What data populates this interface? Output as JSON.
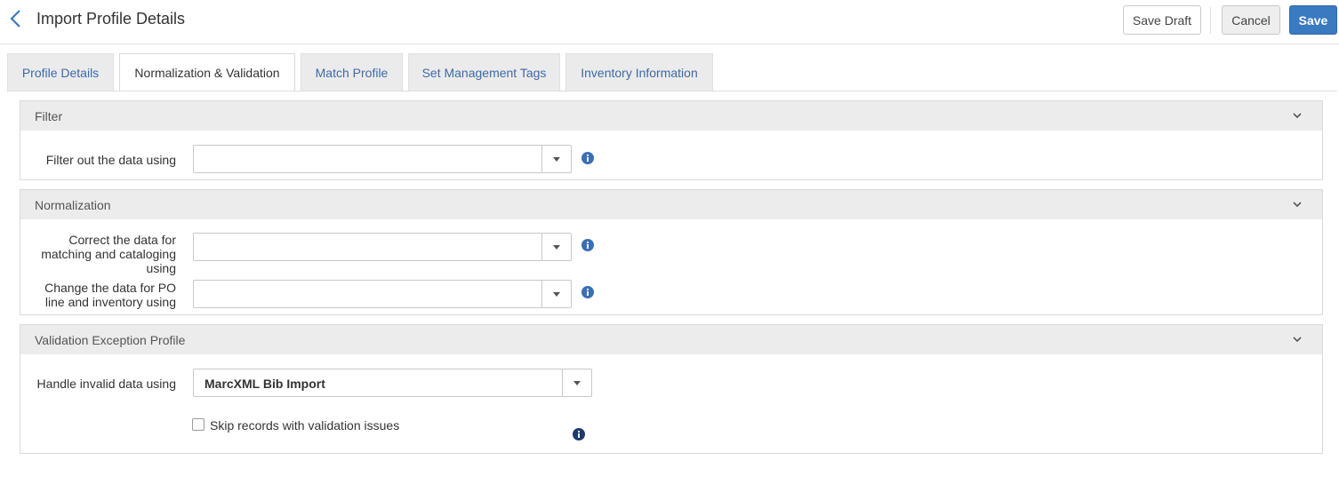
{
  "header": {
    "title": "Import Profile Details",
    "save_draft_label": "Save Draft",
    "cancel_label": "Cancel",
    "save_label": "Save"
  },
  "tabs": [
    {
      "label": "Profile Details",
      "active": false
    },
    {
      "label": "Normalization & Validation",
      "active": true
    },
    {
      "label": "Match Profile",
      "active": false
    },
    {
      "label": "Set Management Tags",
      "active": false
    },
    {
      "label": "Inventory Information",
      "active": false
    }
  ],
  "filter": {
    "title": "Filter",
    "filter_label": "Filter out the data using",
    "filter_value": ""
  },
  "normalization": {
    "title": "Normalization",
    "correct_label": "Correct the data for matching and cataloging using",
    "correct_value": "",
    "change_label": "Change the data for PO line and inventory using",
    "change_value": ""
  },
  "validation": {
    "title": "Validation Exception Profile",
    "handle_label": "Handle invalid data using",
    "handle_value": "MarcXML Bib Import",
    "skip_label": "Skip records with validation issues",
    "skip_checked": false
  },
  "colors": {
    "accent": "#3a7ac1",
    "tab_link": "#3d6aa8",
    "info_icon": "#3a6fb5",
    "info_icon_dark": "#1f3a6b"
  }
}
